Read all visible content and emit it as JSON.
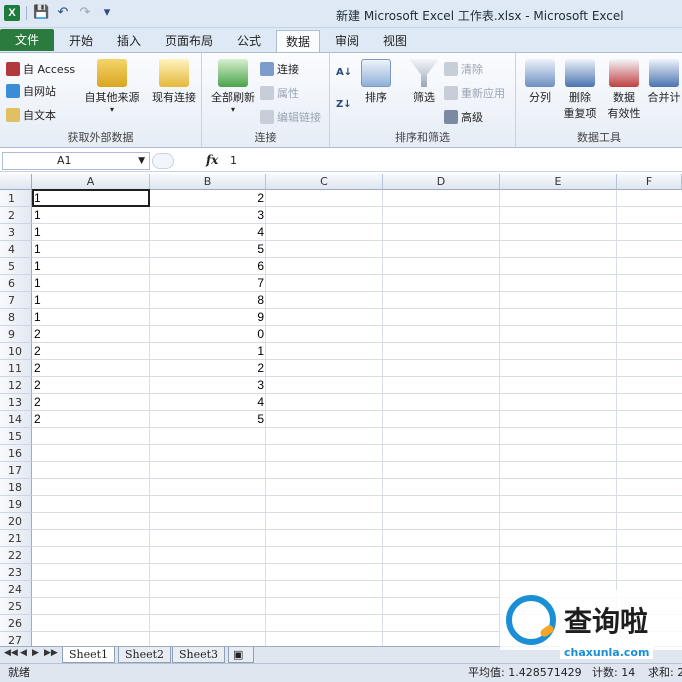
{
  "window": {
    "title": "新建 Microsoft Excel 工作表.xlsx  -  Microsoft Excel"
  },
  "qat": {
    "app_icon": "excel-icon",
    "icons": [
      "save-icon",
      "undo-icon",
      "redo-icon",
      "customize-icon"
    ]
  },
  "tabs": [
    {
      "label": "文件"
    },
    {
      "label": "开始"
    },
    {
      "label": "插入"
    },
    {
      "label": "页面布局"
    },
    {
      "label": "公式"
    },
    {
      "label": "数据"
    },
    {
      "label": "审阅"
    },
    {
      "label": "视图"
    }
  ],
  "active_tab": "数据",
  "ribbon": {
    "external": {
      "label": "获取外部数据",
      "from_access": "自 Access",
      "from_web": "自网站",
      "from_text": "自文本",
      "other_sources": "自其他来源",
      "existing": "现有连接"
    },
    "connections": {
      "label": "连接",
      "refresh_all": "全部刷新",
      "connections": "连接",
      "properties": "属性",
      "edit_links": "编辑链接"
    },
    "sort_filter": {
      "label": "排序和筛选",
      "sort": "排序",
      "filter": "筛选",
      "clear": "清除",
      "reapply": "重新应用",
      "advanced": "高级"
    },
    "data_tools": {
      "label": "数据工具",
      "text_to_columns": "分列",
      "remove_dup_1": "删除",
      "remove_dup_2": "重复项",
      "validation_1": "数据",
      "validation_2": "有效性",
      "consolidate": "合并计"
    }
  },
  "formula_bar": {
    "name_box": "A1",
    "fx": "fx",
    "value": "1"
  },
  "grid": {
    "columns": [
      "A",
      "B",
      "C",
      "D",
      "E",
      "F"
    ],
    "rows": [
      "1",
      "2",
      "3",
      "4",
      "5",
      "6",
      "7",
      "8",
      "9",
      "10",
      "11",
      "12",
      "13",
      "14",
      "15",
      "16",
      "17",
      "18",
      "19",
      "20",
      "21",
      "22",
      "23",
      "24",
      "25",
      "26",
      "27"
    ],
    "colA": [
      "1",
      "1",
      "1",
      "1",
      "1",
      "1",
      "1",
      "1",
      "2",
      "2",
      "2",
      "2",
      "2",
      "2"
    ],
    "colB": [
      "2",
      "3",
      "4",
      "5",
      "6",
      "7",
      "8",
      "9",
      "0",
      "1",
      "2",
      "3",
      "4",
      "5"
    ]
  },
  "sheets": [
    {
      "label": "Sheet1"
    },
    {
      "label": "Sheet2"
    },
    {
      "label": "Sheet3"
    }
  ],
  "status": {
    "ready": "就绪",
    "average": "平均值: 1.428571429",
    "count": "计数: 14",
    "sum": "求和: 2"
  },
  "watermark": {
    "text": "查询啦",
    "url": "chaxunla.com"
  },
  "colors": {
    "file_tab": "#2b7b3f",
    "accent": "#1a8fd6"
  }
}
